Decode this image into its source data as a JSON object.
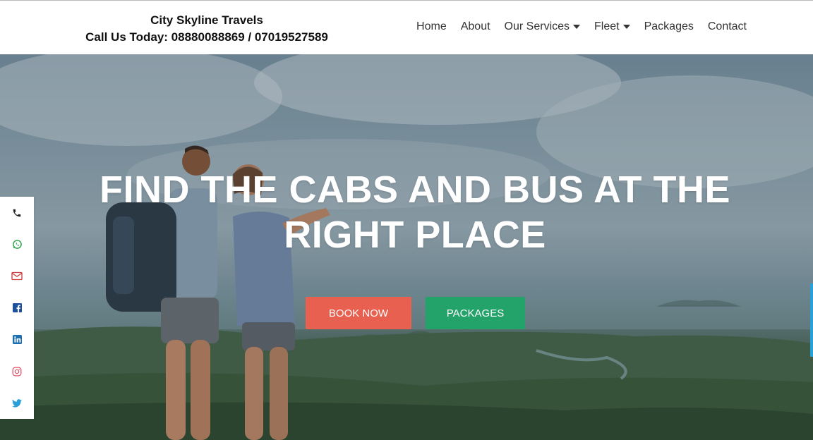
{
  "header": {
    "brand_name": "City Skyline Travels",
    "brand_phone": "Call Us Today: 08880088869 / 07019527589"
  },
  "nav": {
    "home": "Home",
    "about": "About",
    "services": "Our Services",
    "fleet": "Fleet",
    "packages": "Packages",
    "contact": "Contact"
  },
  "hero": {
    "title_line1": "FIND THE CABS AND BUS AT THE",
    "title_line2": "RIGHT PLACE",
    "book_label": "BOOK NOW",
    "packages_label": "PACKAGES"
  },
  "social": {
    "icons": [
      "phone-icon",
      "whatsapp-icon",
      "email-icon",
      "facebook-icon",
      "linkedin-icon",
      "instagram-icon",
      "twitter-icon"
    ]
  },
  "colors": {
    "book_button": "#e8604f",
    "packages_button": "#23a36a",
    "phone": "#222222",
    "whatsapp": "#25a244",
    "email": "#d23b3b",
    "facebook": "#1f4f9c",
    "linkedin": "#1b6fb0",
    "instagram": "#e0556b",
    "twitter": "#2aa0d8"
  }
}
